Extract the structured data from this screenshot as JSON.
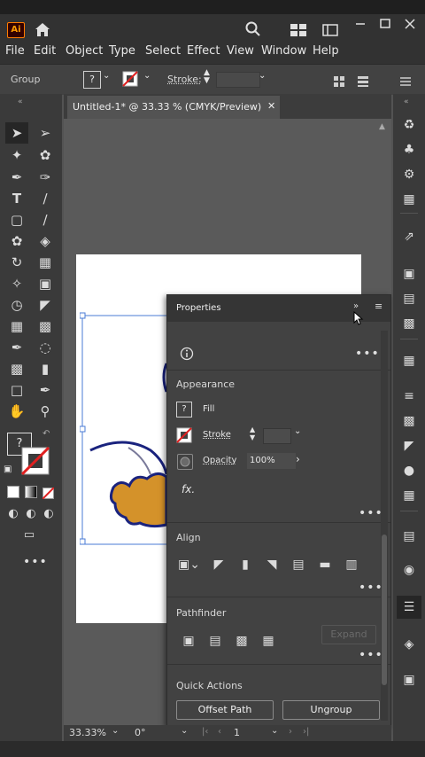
{
  "app": {
    "logo": "Ai"
  },
  "menu": [
    "File",
    "Edit",
    "Object",
    "Type",
    "Select",
    "Effect",
    "View",
    "Window",
    "Help"
  ],
  "control_bar": {
    "selection": "Group",
    "stroke_label": "Stroke:",
    "unknown": "?"
  },
  "document_tab": {
    "title": "Untitled-1* @ 33.33 % (CMYK/Preview)",
    "close": "✕"
  },
  "status": {
    "zoom": "33.33%",
    "rotation": "0°",
    "artboard": "1"
  },
  "properties": {
    "title": "Properties",
    "appearance": {
      "label": "Appearance",
      "fill_label": "Fill",
      "stroke_label": "Stroke",
      "opacity_label": "Opacity",
      "opacity_value": "100%",
      "fx": "fx."
    },
    "align": {
      "label": "Align"
    },
    "pathfinder": {
      "label": "Pathfinder",
      "expand": "Expand"
    },
    "quick_actions": {
      "label": "Quick Actions",
      "offset_path": "Offset Path",
      "ungroup": "Ungroup"
    }
  },
  "colors": {
    "accent": "#ff9a00",
    "selection": "#4a7bd6",
    "panel": "#424242",
    "app_bg": "#535353"
  }
}
